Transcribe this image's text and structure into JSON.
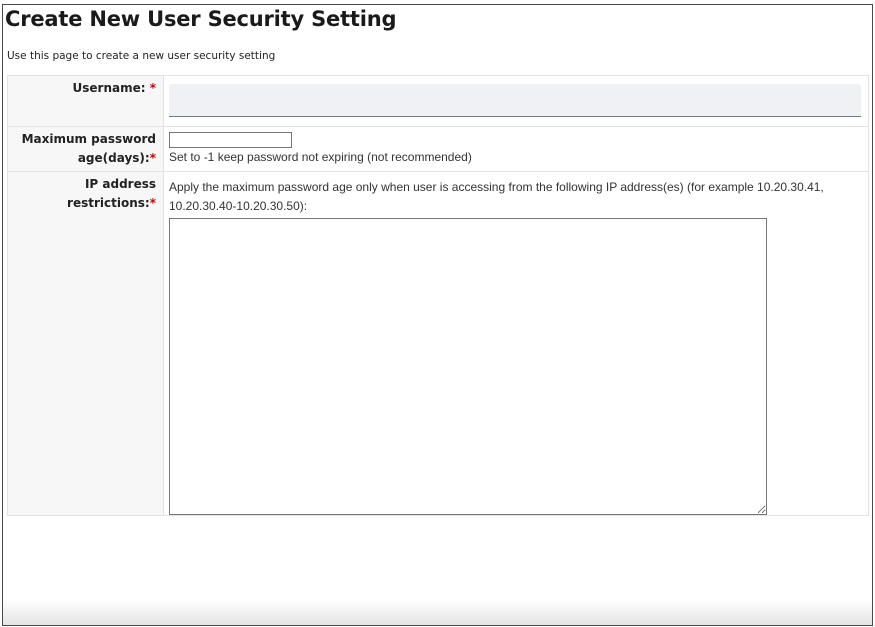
{
  "page": {
    "title": "Create New User Security Setting",
    "description": "Use this page to create a new user security setting"
  },
  "form": {
    "required_marker": "*",
    "username": {
      "label": "Username:",
      "value": "",
      "placeholder": ""
    },
    "max_password_age": {
      "label": "Maximum password age(days):",
      "value": "",
      "hint": "Set to -1 keep password not expiring (not recommended)"
    },
    "ip_restrictions": {
      "label": "IP address restrictions:",
      "hint": "Apply the maximum password age only when user is accessing from the following IP address(es) (for example 10.20.30.41, 10.20.30.40-10.20.30.50):",
      "value": ""
    }
  },
  "colors": {
    "required": "#cc0000",
    "label_background": "#f7f7f7",
    "input_fill": "#eff1f4"
  }
}
